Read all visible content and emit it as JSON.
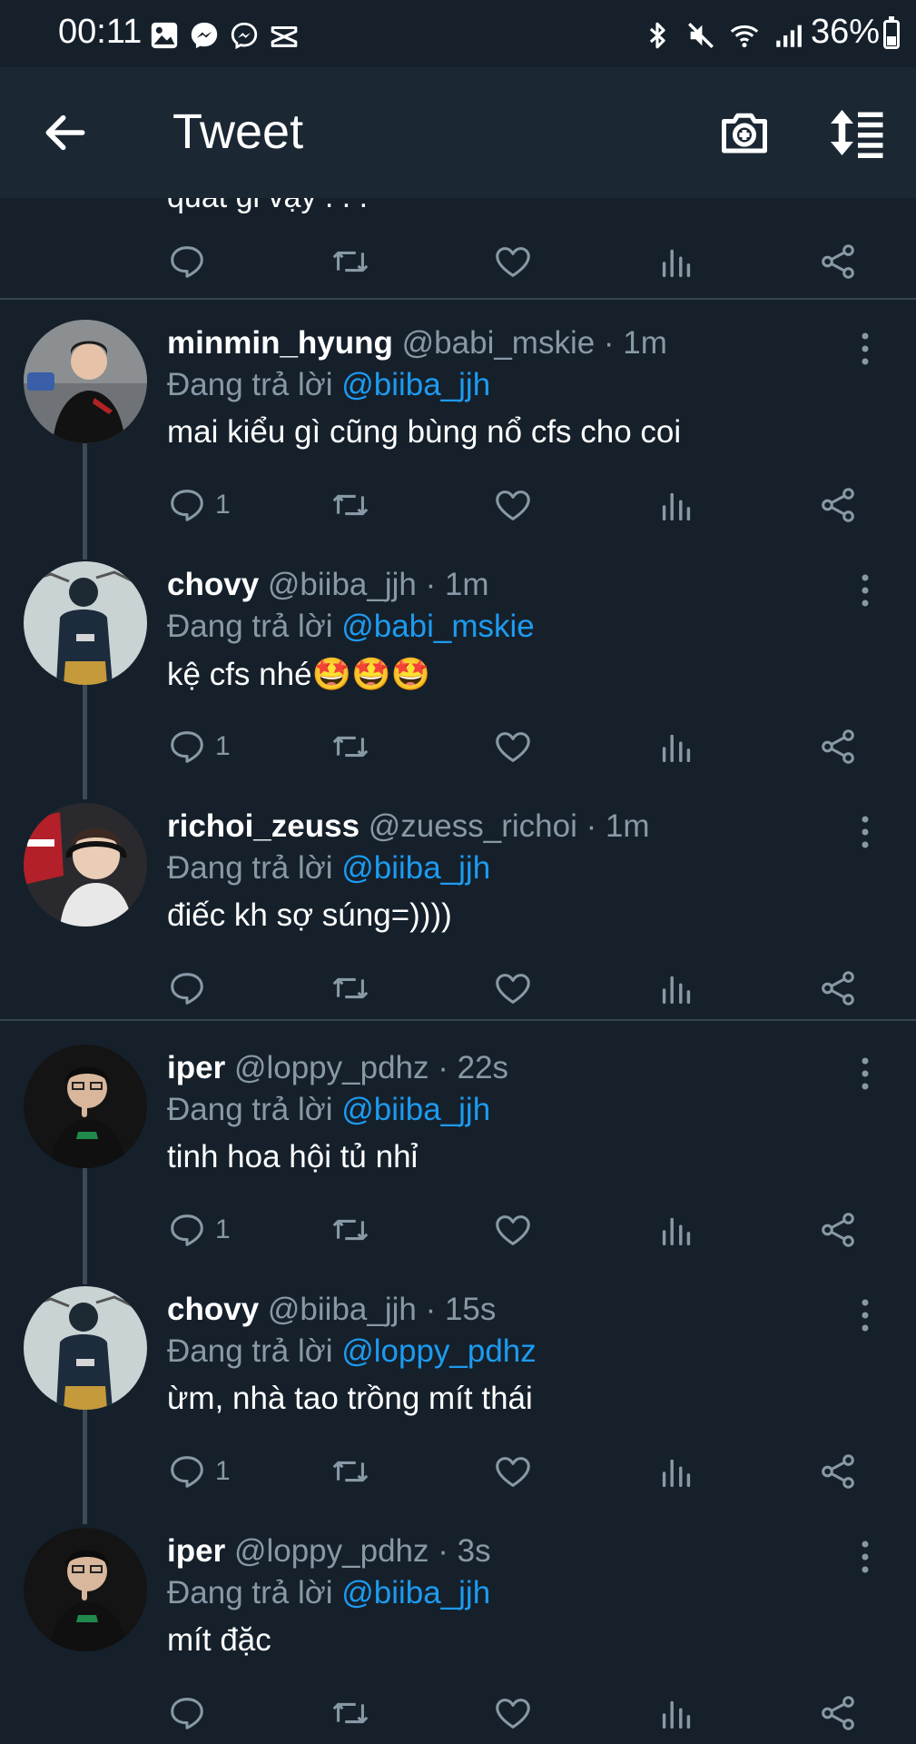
{
  "status_bar": {
    "time": "00:11",
    "battery": "36%",
    "left_icons": [
      "gallery-icon",
      "messenger-icon",
      "messenger-icon",
      "capcut-icon"
    ],
    "right_icons": [
      "bluetooth-icon",
      "mute-icon",
      "wifi-icon",
      "signal-icon"
    ]
  },
  "app_bar": {
    "title": "Tweet"
  },
  "partial_tweet": {
    "text": "quat gi vậy . . ."
  },
  "replying_prefix": "Đang trả lời",
  "tweets": [
    {
      "name": "minmin_hyung",
      "handle": "@babi_mskie · 1m",
      "replying_to": "@biiba_jjh",
      "text": "mai kiểu gì cũng bùng nổ cfs cho coi",
      "reply_count": "1"
    },
    {
      "name": "chovy",
      "handle": "@biiba_jjh · 1m",
      "replying_to": "@babi_mskie",
      "text": "kệ cfs nhé🤩🤩🤩",
      "reply_count": "1"
    },
    {
      "name": "richoi_zeuss",
      "handle": "@zuess_richoi · 1m",
      "replying_to": "@biiba_jjh",
      "text": "điếc kh sợ súng=))))",
      "reply_count": ""
    },
    {
      "name": "iper",
      "handle": "@loppy_pdhz · 22s",
      "replying_to": "@biiba_jjh",
      "text": "tinh hoa hội tủ nhỉ",
      "reply_count": "1"
    },
    {
      "name": "chovy",
      "handle": "@biiba_jjh · 15s",
      "replying_to": "@loppy_pdhz",
      "text": "ừm, nhà tao trồng mít thái",
      "reply_count": "1"
    },
    {
      "name": "iper",
      "handle": "@loppy_pdhz · 3s",
      "replying_to": "@biiba_jjh",
      "text": "mít đặc",
      "reply_count": ""
    }
  ],
  "colors": {
    "background": "#15202b",
    "app_bar": "#1b2733",
    "mention": "#1d9bf0",
    "secondary_text": "#8899a6"
  }
}
